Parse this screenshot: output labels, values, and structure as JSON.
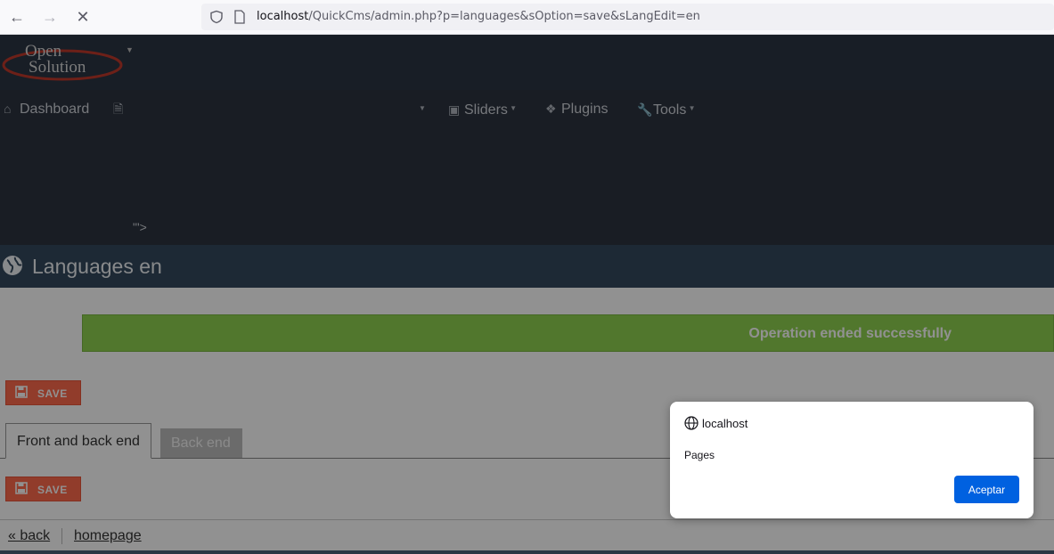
{
  "browser": {
    "url_host": "localhost",
    "url_path": "/QuickCms/admin.php?p=languages&sOption=save&sLangEdit=en"
  },
  "logo": {
    "line1": "Open",
    "line2": "Solution"
  },
  "menu": {
    "dashboard": "Dashboard",
    "sliders": "Sliders",
    "plugins": "Plugins",
    "tools": "Tools",
    "stray_text": "\"'>"
  },
  "page": {
    "title": "Languages en"
  },
  "messages": {
    "success": "Operation ended successfully"
  },
  "buttons": {
    "save": "SAVE"
  },
  "tabs": [
    {
      "label": "Front and back end",
      "active": true
    },
    {
      "label": "Back end",
      "active": false
    }
  ],
  "footer": {
    "back": "« back",
    "homepage": "homepage"
  },
  "dialog": {
    "origin": "localhost",
    "message": "Pages",
    "ok": "Aceptar"
  },
  "colors": {
    "header": "#2b3644",
    "success": "#8fd14f",
    "save": "#ff6a4d",
    "accent": "#0061e0"
  }
}
